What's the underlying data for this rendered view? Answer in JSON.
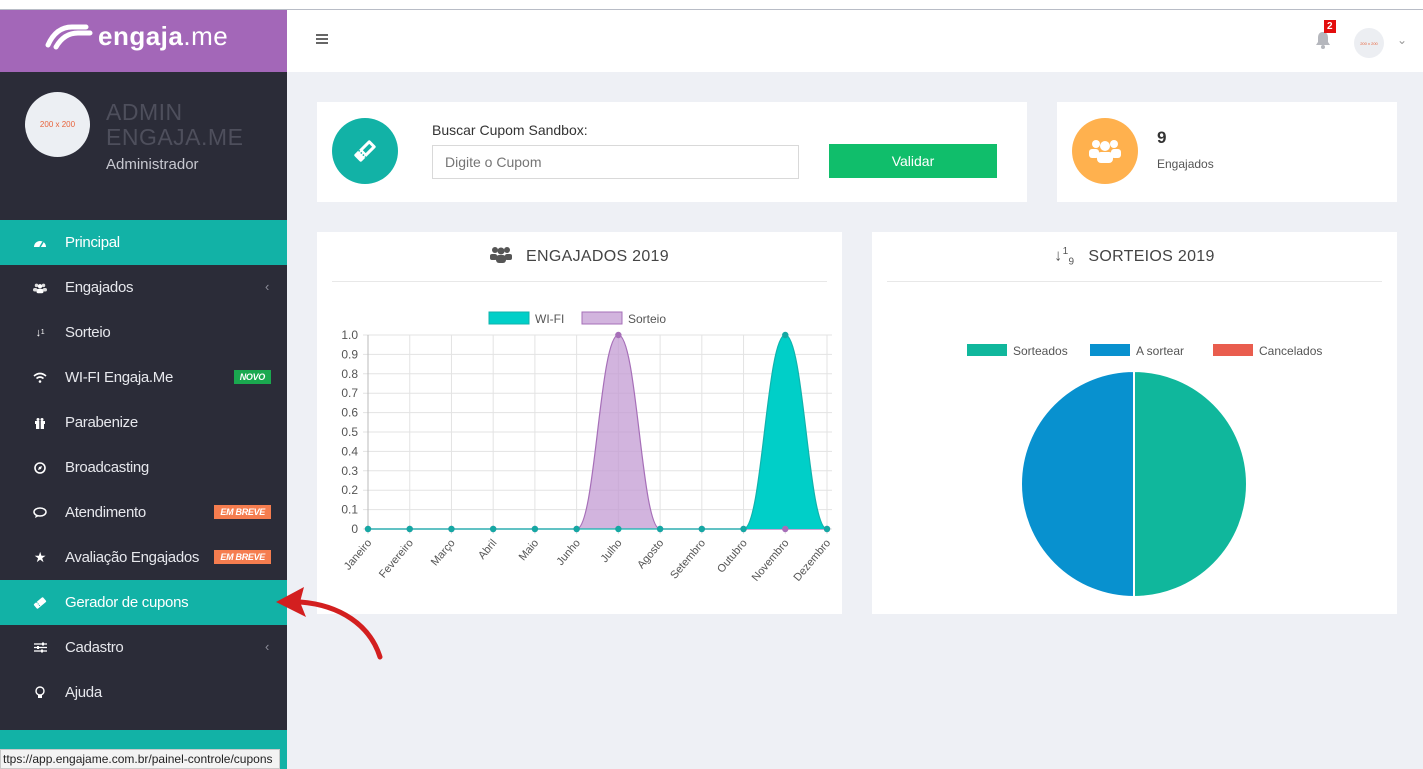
{
  "brand": {
    "name_bold": "engaja",
    "name_light": ".me"
  },
  "profile": {
    "avatar_text": "200 x 200",
    "name_line1": "ADMIN",
    "name_line2": "ENGAJA.ME",
    "role": "Administrador"
  },
  "menu": [
    {
      "label": "Principal",
      "icon": "dashboard-icon",
      "active": true
    },
    {
      "label": "Engajados",
      "icon": "users-icon",
      "chevron": true
    },
    {
      "label": "Sorteio",
      "icon": "sort-numeric-icon"
    },
    {
      "label": "WI-FI Engaja.Me",
      "icon": "wifi-icon",
      "badge": "NOVO"
    },
    {
      "label": "Parabenize",
      "icon": "gift-icon"
    },
    {
      "label": "Broadcasting",
      "icon": "compass-icon"
    },
    {
      "label": "Atendimento",
      "icon": "chat-icon",
      "badge": "EM BREVE"
    },
    {
      "label": "Avaliação Engajados",
      "icon": "star-icon",
      "badge": "EM BREVE"
    },
    {
      "label": "Gerador de cupons",
      "icon": "ticket-icon",
      "active": true
    },
    {
      "label": "Cadastro",
      "icon": "sliders-icon",
      "chevron": true
    },
    {
      "label": "Ajuda",
      "icon": "lightbulb-icon"
    }
  ],
  "status_url": "ttps://app.engajame.com.br/painel-controle/cupons",
  "header": {
    "notification_count": "2",
    "user_avatar_text": "200 x 200"
  },
  "coupon": {
    "label": "Buscar Cupom Sandbox:",
    "placeholder": "Digite o Cupom",
    "button": "Validar"
  },
  "engaged": {
    "count": "9",
    "label": "Engajados"
  },
  "colors": {
    "teal": "#12b2a6",
    "green": "#10be6b",
    "orange": "#ffb14e",
    "sidebar": "#2b2c38",
    "brand": "#a367b8"
  },
  "charts": {
    "engajados_title": "ENGAJADOS 2019",
    "sorteios_title": "SORTEIOS 2019"
  },
  "chart_data": [
    {
      "type": "area",
      "title": "ENGAJADOS 2019",
      "categories": [
        "Janeiro",
        "Fevereiro",
        "Março",
        "Abril",
        "Maio",
        "Junho",
        "Julho",
        "Agosto",
        "Setembro",
        "Outubro",
        "Novembro",
        "Dezembro"
      ],
      "series": [
        {
          "name": "WI-FI",
          "color": "#00cfc8",
          "values": [
            0,
            0,
            0,
            0,
            0,
            0,
            0,
            0,
            0,
            0,
            1,
            0
          ]
        },
        {
          "name": "Sorteio",
          "color": "#c39bd3",
          "values": [
            0,
            0,
            0,
            0,
            0,
            0,
            1,
            0,
            0,
            0,
            0,
            0
          ]
        }
      ],
      "ylim": [
        0,
        1
      ],
      "yticks": [
        "0",
        "0.1",
        "0.2",
        "0.3",
        "0.4",
        "0.5",
        "0.6",
        "0.7",
        "0.8",
        "0.9",
        "1.0"
      ],
      "grid": true,
      "legend": "top"
    },
    {
      "type": "pie",
      "title": "SORTEIOS 2019",
      "categories": [
        "Sorteados",
        "A sortear",
        "Cancelados"
      ],
      "values": [
        1,
        1,
        0
      ],
      "colors": [
        "#10b79c",
        "#0891cf",
        "#e95d4e"
      ],
      "legend": "top"
    }
  ]
}
